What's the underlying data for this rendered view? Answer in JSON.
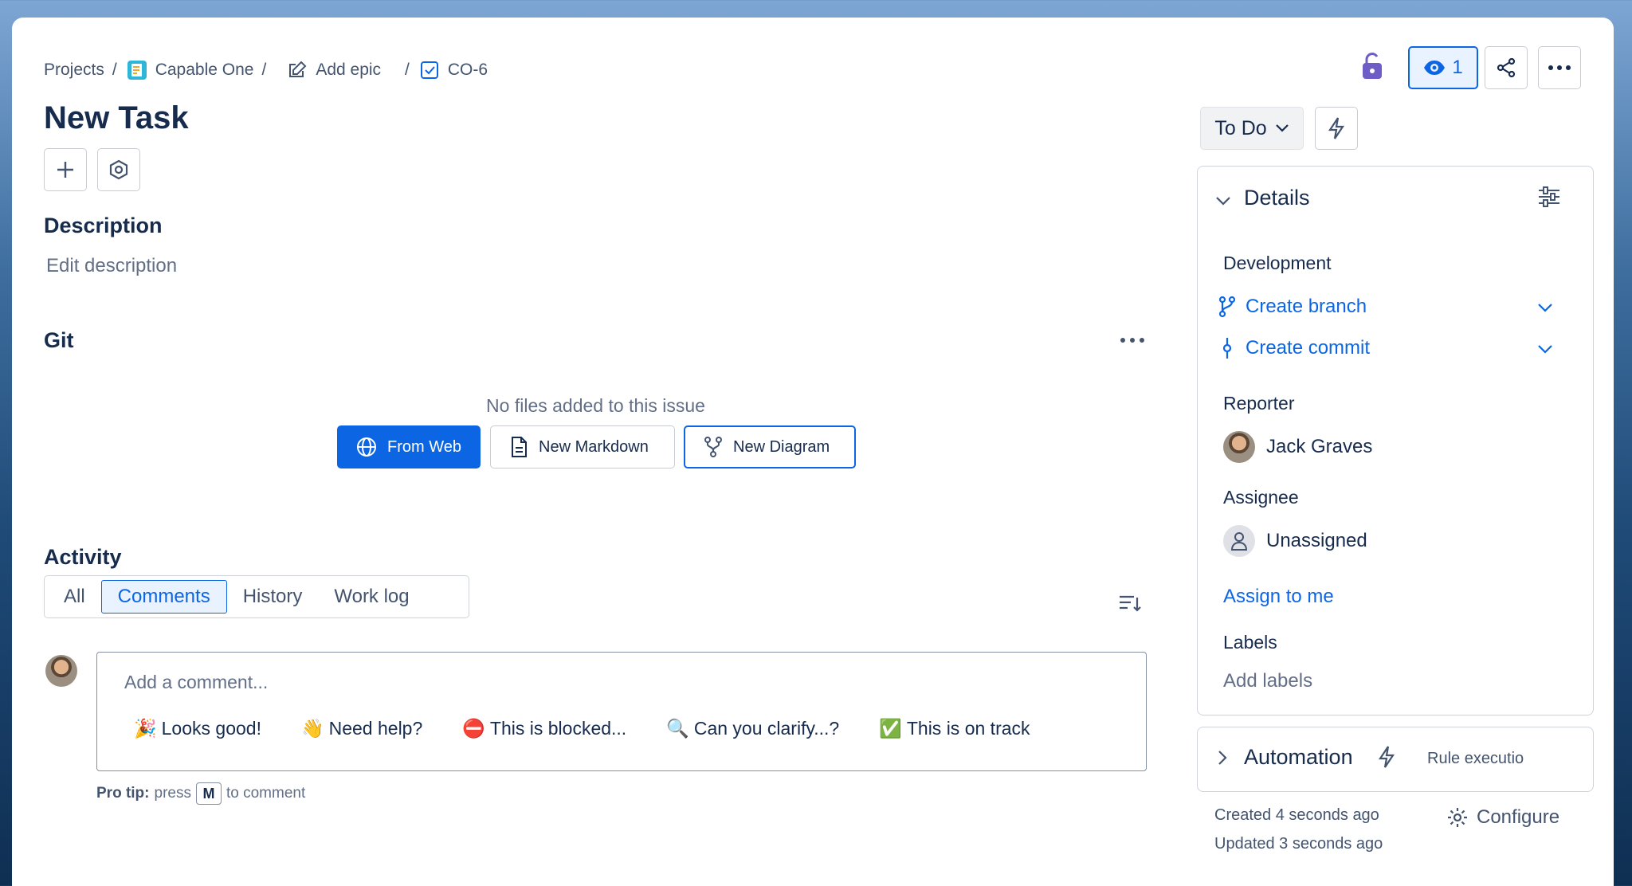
{
  "breadcrumb": {
    "projects": "Projects",
    "project": "Capable One",
    "epic": "Add epic",
    "issue_key": "CO-6"
  },
  "issue": {
    "title": "New Task"
  },
  "description": {
    "heading": "Description",
    "placeholder": "Edit description"
  },
  "git": {
    "heading": "Git",
    "empty_text": "No files added to this issue",
    "from_web": "From Web",
    "new_markdown": "New Markdown",
    "new_diagram": "New Diagram"
  },
  "activity": {
    "heading": "Activity",
    "tabs": [
      "All",
      "Comments",
      "History",
      "Work log"
    ],
    "active_tab": "Comments",
    "comment_placeholder": "Add a comment...",
    "quick_replies": [
      {
        "emoji": "🎉",
        "text": "Looks good!"
      },
      {
        "emoji": "👋",
        "text": "Need help?"
      },
      {
        "emoji": "⛔",
        "text": "This is blocked..."
      },
      {
        "emoji": "🔍",
        "text": "Can you clarify...?"
      },
      {
        "emoji": "✅",
        "text": "This is on track"
      }
    ],
    "pro_tip_label": "Pro tip:",
    "pro_tip_press": "press",
    "pro_tip_key": "M",
    "pro_tip_suffix": "to comment"
  },
  "header_actions": {
    "watch_count": "1"
  },
  "status": {
    "label": "To Do"
  },
  "details": {
    "heading": "Details",
    "development_label": "Development",
    "create_branch": "Create branch",
    "create_commit": "Create commit",
    "reporter_label": "Reporter",
    "reporter_name": "Jack Graves",
    "assignee_label": "Assignee",
    "assignee_name": "Unassigned",
    "assign_to_me": "Assign to me",
    "labels_label": "Labels",
    "labels_placeholder": "Add labels"
  },
  "automation": {
    "heading": "Automation",
    "rule_text": "Rule executio"
  },
  "meta": {
    "created": "Created 4 seconds ago",
    "updated": "Updated 3 seconds ago",
    "configure": "Configure"
  },
  "colors": {
    "accent": "#0c66e4",
    "text": "#172b4d",
    "muted": "#626f86",
    "lock": "#6e5dc6"
  }
}
